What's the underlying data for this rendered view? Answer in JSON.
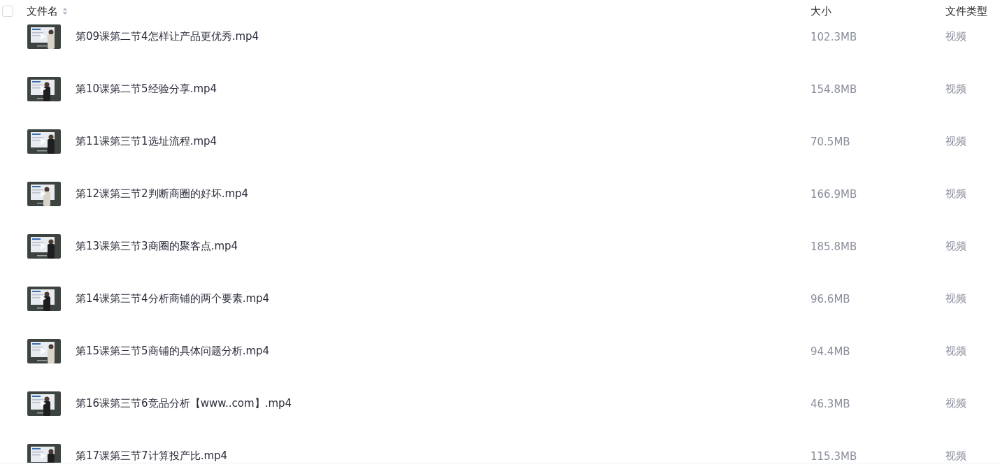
{
  "header": {
    "select_all": {
      "checked": false
    },
    "columns": [
      {
        "label": "文件名"
      },
      {
        "label": "大小"
      },
      {
        "label": "文件类型"
      }
    ]
  },
  "files": [
    {
      "name": "第09课第二节4怎样让产品更优秀.mp4",
      "size": "102.3MB",
      "type": "视频"
    },
    {
      "name": "第10课第二节5经验分享.mp4",
      "size": "154.8MB",
      "type": "视频"
    },
    {
      "name": "第11课第三节1选址流程.mp4",
      "size": "70.5MB",
      "type": "视频"
    },
    {
      "name": "第12课第三节2判断商圈的好坏.mp4",
      "size": "166.9MB",
      "type": "视频"
    },
    {
      "name": "第13课第三节3商圈的聚客点.mp4",
      "size": "185.8MB",
      "type": "视频"
    },
    {
      "name": "第14课第三节4分析商铺的两个要素.mp4",
      "size": "96.6MB",
      "type": "视频"
    },
    {
      "name": "第15课第三节5商铺的具体问题分析.mp4",
      "size": "94.4MB",
      "type": "视频"
    },
    {
      "name": "第16课第三节6竞品分析【www..com】.mp4",
      "size": "46.3MB",
      "type": "视频"
    },
    {
      "name": "第17课第三节7计算投产比.mp4",
      "size": "115.3MB",
      "type": "视频"
    }
  ]
}
